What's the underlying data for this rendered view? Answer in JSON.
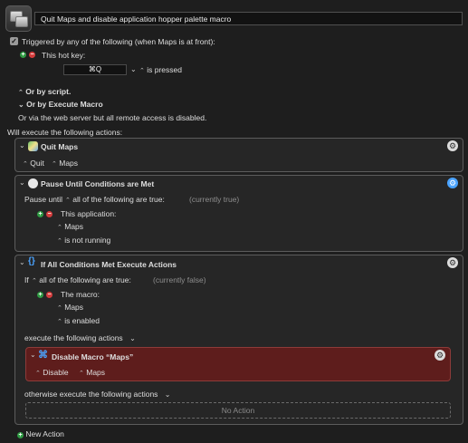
{
  "header": {
    "macro_name": "Quit Maps and disable application hopper palette macro"
  },
  "trigger": {
    "checkbox_label": "Triggered by any of the following (when Maps is at front):",
    "hotkey_title": "This hot key:",
    "hotkey_value": "⌘Q",
    "hotkey_state": "is pressed",
    "or_by_script": "Or by script.",
    "or_by_execute_macro": "Or by Execute Macro",
    "web_server_note": "Or via the web server but all remote access is disabled.",
    "will_execute": "Will execute the following actions:"
  },
  "actions": {
    "quit": {
      "title": "Quit Maps",
      "mode": "Quit",
      "app": "Maps"
    },
    "pause": {
      "title": "Pause Until Conditions are Met",
      "pause_until": "Pause until",
      "condition": "all of the following are true:",
      "status": "(currently true)",
      "sub_title": "This application:",
      "app": "Maps",
      "state": "is not running"
    },
    "if": {
      "title": "If All Conditions Met Execute Actions",
      "if_label": "If",
      "condition": "all of the following are true:",
      "status": "(currently false)",
      "sub_title": "The macro:",
      "macro": "Maps",
      "state": "is enabled",
      "execute_label": "execute the following actions",
      "otherwise_label": "otherwise execute the following actions",
      "no_action": "No Action",
      "inner": {
        "title": "Disable Macro “Maps”",
        "mode": "Disable",
        "macro": "Maps"
      }
    }
  },
  "footer": {
    "new_action": "New Action"
  },
  "colors": {
    "background": "#1e1e1e",
    "panel": "#262626",
    "accent_blue": "#4aa3ff",
    "disable_panel": "#5e1d1c",
    "plus_green": "#2f9b43",
    "minus_red": "#d43c3c"
  }
}
